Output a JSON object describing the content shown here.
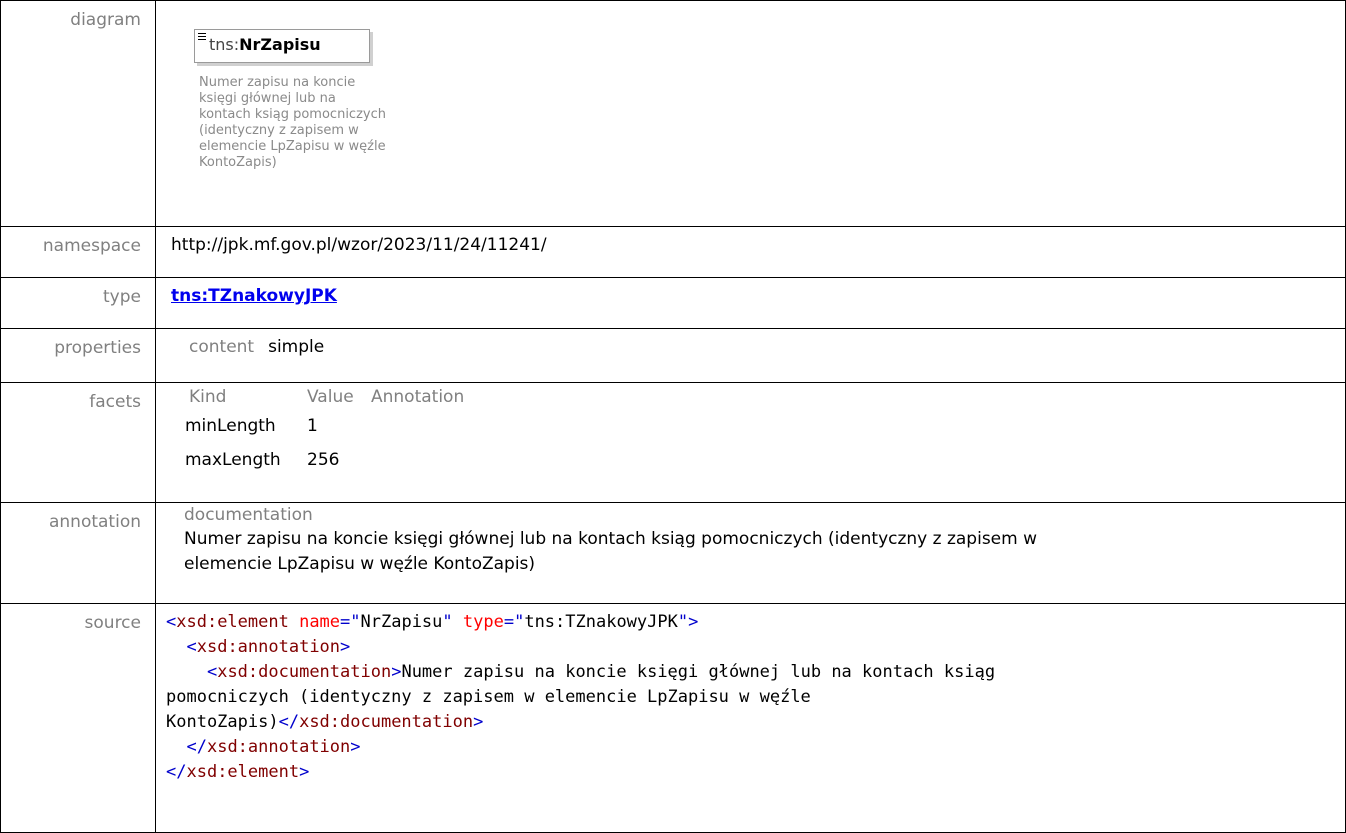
{
  "labels": {
    "diagram": "diagram",
    "namespace": "namespace",
    "type": "type",
    "properties": "properties",
    "facets": "facets",
    "annotation": "annotation",
    "source": "source"
  },
  "diagram": {
    "prefix": "tns:",
    "name": "NrZapisu",
    "doc_lines": [
      "Numer zapisu na koncie",
      "księgi głównej lub na",
      "kontach ksiąg pomocniczych",
      "(identyczny z zapisem w",
      "elemencie LpZapisu w węźle",
      "KontoZapis)"
    ]
  },
  "namespace": "http://jpk.mf.gov.pl/wzor/2023/11/24/11241/",
  "type": "tns:TZnakowyJPK",
  "properties": {
    "key": "content",
    "value": "simple"
  },
  "facets": {
    "headers": [
      "Kind",
      "Value",
      "Annotation"
    ],
    "rows": [
      {
        "kind": "minLength",
        "value": "1",
        "annotation": ""
      },
      {
        "kind": "maxLength",
        "value": "256",
        "annotation": ""
      }
    ]
  },
  "annotation": {
    "heading": "documentation",
    "line1": "Numer zapisu na koncie księgi głównej lub na kontach ksiąg pomocniczych (identyczny z zapisem w",
    "line2": "elemencie LpZapisu w węźle KontoZapis)"
  },
  "source": {
    "l1_open": "<",
    "l1_tag": "xsd:element",
    "l1_attr1": " name",
    "l1_eq1": "=\"",
    "l1_val1": "NrZapisu",
    "l1_q1": "\"",
    "l1_attr2": " type",
    "l1_eq2": "=\"",
    "l1_val2": "tns:TZnakowyJPK",
    "l1_close": "\">",
    "l2_indent": "  ",
    "l2_open": "<",
    "l2_tag": "xsd:annotation",
    "l2_close": ">",
    "l3_indent": "    ",
    "l3_open": "<",
    "l3_tag": "xsd:documentation",
    "l3_close": ">",
    "l3_text": "Numer zapisu na koncie księgi głównej lub na kontach ksiąg",
    "l4_text": "pomocniczych (identyczny z zapisem w elemencie LpZapisu w węźle",
    "l5_text": "KontoZapis)",
    "l5_endopen": "</",
    "l5_tag": "xsd:documentation",
    "l5_close": ">",
    "l6_indent": "  ",
    "l6_open": "</",
    "l6_tag": "xsd:annotation",
    "l6_close": ">",
    "l7_open": "</",
    "l7_tag": "xsd:element",
    "l7_close": ">"
  }
}
